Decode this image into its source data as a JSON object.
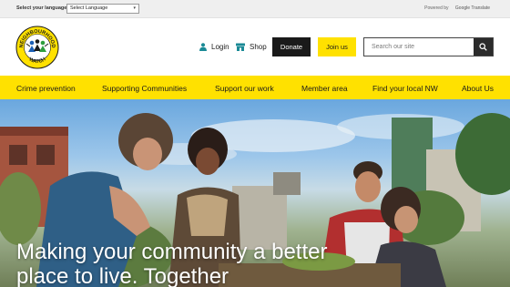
{
  "language_bar": {
    "label": "Select your language:",
    "select_value": "Select Language",
    "powered_by": "Powered by",
    "google_translate": "Google Translate"
  },
  "header": {
    "logo_top_text": "NEIGHBOURHOOD",
    "logo_bottom_text": "WATCH",
    "login_label": "Login",
    "shop_label": "Shop",
    "donate_label": "Donate",
    "join_label": "Join us",
    "search_placeholder": "Search our site"
  },
  "nav": {
    "items": [
      {
        "label": "Crime prevention"
      },
      {
        "label": "Supporting Communities"
      },
      {
        "label": "Support our work"
      },
      {
        "label": "Member area"
      },
      {
        "label": "Find your local NW"
      },
      {
        "label": "About Us"
      }
    ]
  },
  "hero": {
    "title": "Making your community a better place to live. Together"
  },
  "colors": {
    "brand_yellow": "#ffe100",
    "dark": "#1a1a1a",
    "icon_teal": "#1b8a96"
  }
}
